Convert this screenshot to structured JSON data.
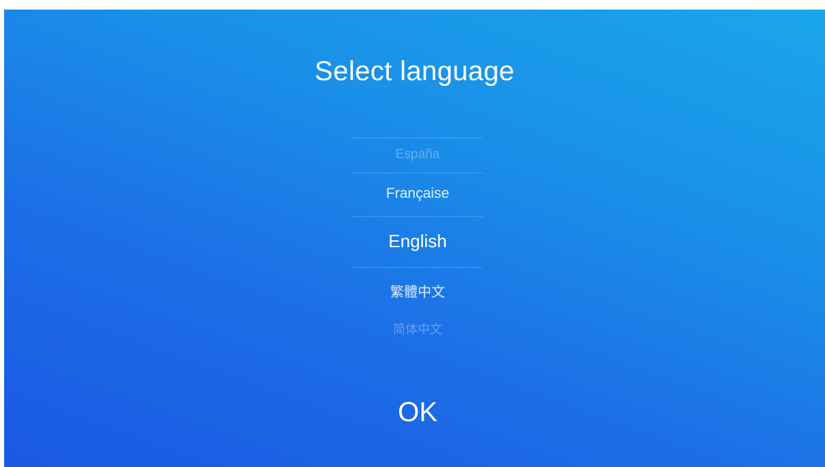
{
  "screen": {
    "title": "Select language",
    "ok_label": "OK"
  },
  "languages": {
    "selected": "English",
    "options": [
      {
        "label": "España",
        "state": "faded"
      },
      {
        "label": "Française",
        "state": "adjacent"
      },
      {
        "label": "English",
        "state": "selected"
      },
      {
        "label": "繁體中文",
        "state": "adjacent"
      },
      {
        "label": "简体中文",
        "state": "faded"
      }
    ]
  },
  "colors": {
    "background_top_right": "#1aa6ea",
    "background_bottom_left": "#1b58e3",
    "text": "#ffffff"
  }
}
